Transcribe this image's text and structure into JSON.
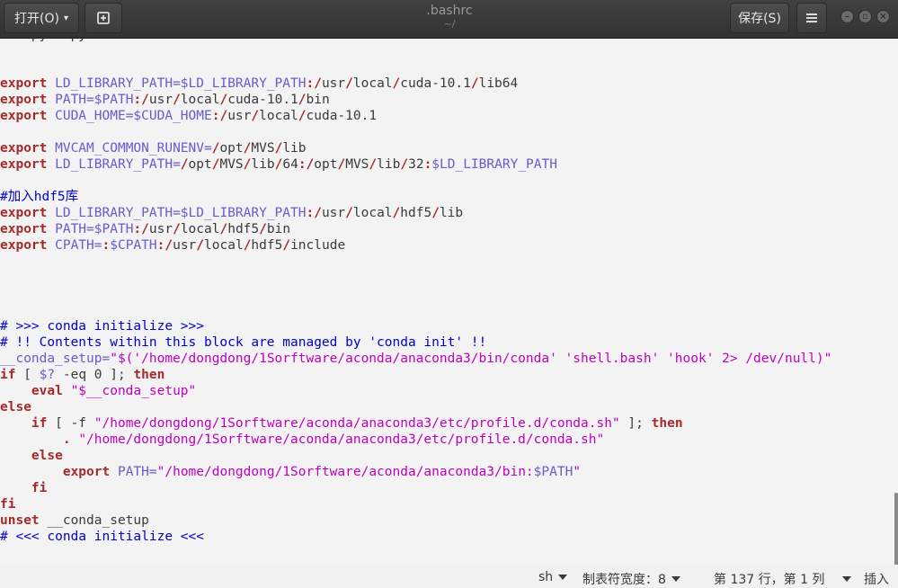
{
  "window": {
    "title": ".bashrc",
    "subtitle": "~/",
    "open_label": "打开(O)",
    "save_label": "保存(S)"
  },
  "code_lines": [
    [
      {
        "t": "    py   py",
        "c": "plain"
      }
    ],
    [],
    [],
    [
      {
        "t": "export",
        "c": "kw"
      },
      {
        "t": " LD_LIBRARY_PATH=$LD_LIBRARY_PATH",
        "c": "var"
      },
      {
        "t": ":",
        "c": "slash"
      },
      {
        "t": "/",
        "c": "slash"
      },
      {
        "t": "usr",
        "c": "plain"
      },
      {
        "t": "/",
        "c": "slash"
      },
      {
        "t": "local",
        "c": "plain"
      },
      {
        "t": "/",
        "c": "slash"
      },
      {
        "t": "cuda-10.1",
        "c": "plain"
      },
      {
        "t": "/",
        "c": "slash"
      },
      {
        "t": "lib64",
        "c": "plain"
      }
    ],
    [
      {
        "t": "export",
        "c": "kw"
      },
      {
        "t": " PATH=$PATH",
        "c": "var"
      },
      {
        "t": ":/",
        "c": "slash"
      },
      {
        "t": "usr",
        "c": "plain"
      },
      {
        "t": "/",
        "c": "slash"
      },
      {
        "t": "local",
        "c": "plain"
      },
      {
        "t": "/",
        "c": "slash"
      },
      {
        "t": "cuda-10.1",
        "c": "plain"
      },
      {
        "t": "/",
        "c": "slash"
      },
      {
        "t": "bin",
        "c": "plain"
      }
    ],
    [
      {
        "t": "export",
        "c": "kw"
      },
      {
        "t": " CUDA_HOME=$CUDA_HOME",
        "c": "var"
      },
      {
        "t": ":/",
        "c": "slash"
      },
      {
        "t": "usr",
        "c": "plain"
      },
      {
        "t": "/",
        "c": "slash"
      },
      {
        "t": "local",
        "c": "plain"
      },
      {
        "t": "/",
        "c": "slash"
      },
      {
        "t": "cuda-10.1",
        "c": "plain"
      }
    ],
    [],
    [
      {
        "t": "export",
        "c": "kw"
      },
      {
        "t": " MVCAM_COMMON_RUNENV=",
        "c": "var"
      },
      {
        "t": "/",
        "c": "slash"
      },
      {
        "t": "opt",
        "c": "plain"
      },
      {
        "t": "/",
        "c": "slash"
      },
      {
        "t": "MVS",
        "c": "plain"
      },
      {
        "t": "/",
        "c": "slash"
      },
      {
        "t": "lib",
        "c": "plain"
      }
    ],
    [
      {
        "t": "export",
        "c": "kw"
      },
      {
        "t": " LD_LIBRARY_PATH=",
        "c": "var"
      },
      {
        "t": "/",
        "c": "slash"
      },
      {
        "t": "opt",
        "c": "plain"
      },
      {
        "t": "/",
        "c": "slash"
      },
      {
        "t": "MVS",
        "c": "plain"
      },
      {
        "t": "/",
        "c": "slash"
      },
      {
        "t": "lib",
        "c": "plain"
      },
      {
        "t": "/",
        "c": "slash"
      },
      {
        "t": "64",
        "c": "plain"
      },
      {
        "t": ":/",
        "c": "slash"
      },
      {
        "t": "opt",
        "c": "plain"
      },
      {
        "t": "/",
        "c": "slash"
      },
      {
        "t": "MVS",
        "c": "plain"
      },
      {
        "t": "/",
        "c": "slash"
      },
      {
        "t": "lib",
        "c": "plain"
      },
      {
        "t": "/",
        "c": "slash"
      },
      {
        "t": "32",
        "c": "plain"
      },
      {
        "t": ":",
        "c": "slash"
      },
      {
        "t": "$LD_LIBRARY_PATH",
        "c": "var"
      }
    ],
    [],
    [
      {
        "t": "#加入hdf5库",
        "c": "cm"
      }
    ],
    [
      {
        "t": "export",
        "c": "kw"
      },
      {
        "t": " LD_LIBRARY_PATH=$LD_LIBRARY_PATH",
        "c": "var"
      },
      {
        "t": ":/",
        "c": "slash"
      },
      {
        "t": "usr",
        "c": "plain"
      },
      {
        "t": "/",
        "c": "slash"
      },
      {
        "t": "local",
        "c": "plain"
      },
      {
        "t": "/",
        "c": "slash"
      },
      {
        "t": "hdf5",
        "c": "plain"
      },
      {
        "t": "/",
        "c": "slash"
      },
      {
        "t": "lib",
        "c": "plain"
      }
    ],
    [
      {
        "t": "export",
        "c": "kw"
      },
      {
        "t": " PATH=$PATH",
        "c": "var"
      },
      {
        "t": ":/",
        "c": "slash"
      },
      {
        "t": "usr",
        "c": "plain"
      },
      {
        "t": "/",
        "c": "slash"
      },
      {
        "t": "local",
        "c": "plain"
      },
      {
        "t": "/",
        "c": "slash"
      },
      {
        "t": "hdf5",
        "c": "plain"
      },
      {
        "t": "/",
        "c": "slash"
      },
      {
        "t": "bin",
        "c": "plain"
      }
    ],
    [
      {
        "t": "export",
        "c": "kw"
      },
      {
        "t": " CPATH=",
        "c": "var"
      },
      {
        "t": ":",
        "c": "slash"
      },
      {
        "t": "$CPATH",
        "c": "var"
      },
      {
        "t": ":/",
        "c": "slash"
      },
      {
        "t": "usr",
        "c": "plain"
      },
      {
        "t": "/",
        "c": "slash"
      },
      {
        "t": "local",
        "c": "plain"
      },
      {
        "t": "/",
        "c": "slash"
      },
      {
        "t": "hdf5",
        "c": "plain"
      },
      {
        "t": "/",
        "c": "slash"
      },
      {
        "t": "include",
        "c": "plain"
      }
    ],
    [],
    [],
    [],
    [],
    [
      {
        "t": "# >>> conda initialize >>>",
        "c": "cm"
      }
    ],
    [
      {
        "t": "# !! Contents within this block are managed by 'conda init' !!",
        "c": "cm"
      }
    ],
    [
      {
        "t": "__conda_setup=",
        "c": "var"
      },
      {
        "t": "\"$('/home/dongdong/1Sorftware/aconda/anaconda3/bin/conda' 'shell.bash' 'hook' 2> /dev/null)\"",
        "c": "str"
      }
    ],
    [
      {
        "t": "if",
        "c": "kw"
      },
      {
        "t": " [ ",
        "c": "plain"
      },
      {
        "t": "$?",
        "c": "var"
      },
      {
        "t": " -eq 0 ]",
        "c": "plain"
      },
      {
        "t": "; ",
        "c": "plain"
      },
      {
        "t": "then",
        "c": "kw"
      }
    ],
    [
      {
        "t": "    ",
        "c": "plain"
      },
      {
        "t": "eval",
        "c": "kw"
      },
      {
        "t": " ",
        "c": "plain"
      },
      {
        "t": "\"$__conda_setup\"",
        "c": "str"
      }
    ],
    [
      {
        "t": "else",
        "c": "kw"
      }
    ],
    [
      {
        "t": "    ",
        "c": "plain"
      },
      {
        "t": "if",
        "c": "kw"
      },
      {
        "t": " [ -f ",
        "c": "plain"
      },
      {
        "t": "\"/home/dongdong/1Sorftware/aconda/anaconda3/etc/profile.d/conda.sh\"",
        "c": "str"
      },
      {
        "t": " ]",
        "c": "plain"
      },
      {
        "t": "; ",
        "c": "plain"
      },
      {
        "t": "then",
        "c": "kw"
      }
    ],
    [
      {
        "t": "        ",
        "c": "plain"
      },
      {
        "t": ".",
        "c": "kw"
      },
      {
        "t": " ",
        "c": "plain"
      },
      {
        "t": "\"/home/dongdong/1Sorftware/aconda/anaconda3/etc/profile.d/conda.sh\"",
        "c": "str"
      }
    ],
    [
      {
        "t": "    ",
        "c": "plain"
      },
      {
        "t": "else",
        "c": "kw"
      }
    ],
    [
      {
        "t": "        ",
        "c": "plain"
      },
      {
        "t": "export",
        "c": "kw"
      },
      {
        "t": " PATH=",
        "c": "var"
      },
      {
        "t": "\"/home/dongdong/1Sorftware/aconda/anaconda3/bin:",
        "c": "str"
      },
      {
        "t": "$PATH",
        "c": "var"
      },
      {
        "t": "\"",
        "c": "str"
      }
    ],
    [
      {
        "t": "    ",
        "c": "plain"
      },
      {
        "t": "fi",
        "c": "kw"
      }
    ],
    [
      {
        "t": "fi",
        "c": "kw"
      }
    ],
    [
      {
        "t": "unset",
        "c": "kw"
      },
      {
        "t": " __conda_setup",
        "c": "plain"
      }
    ],
    [
      {
        "t": "# <<< conda initialize <<<",
        "c": "cm"
      }
    ]
  ],
  "status": {
    "language": "sh",
    "tab_width": "制表符宽度：8",
    "position": "第 137 行，第 1 列",
    "mode": "插入"
  }
}
